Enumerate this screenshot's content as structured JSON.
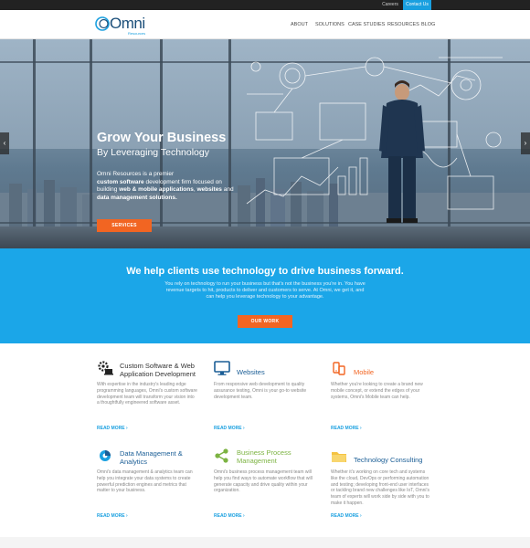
{
  "topbar": {
    "careers": "Careers",
    "contact": "Contact Us"
  },
  "brand": {
    "name": "Omni",
    "tagline": "Resources"
  },
  "nav": [
    {
      "label": "ABOUT"
    },
    {
      "label": "SOLUTIONS"
    },
    {
      "label": "CASE STUDIES"
    },
    {
      "label": "RESOURCES"
    },
    {
      "label": "BLOG"
    }
  ],
  "hero": {
    "title": "Grow Your Business",
    "subtitle": "By Leveraging Technology",
    "body_1": "Omni Resources is a premier",
    "body_2": "custom software",
    "body_3": " development firm focused on building ",
    "body_4": "web & mobile applications",
    "body_5": ", ",
    "body_6": "websites",
    "body_7": " and ",
    "body_8": "data management solutions.",
    "button": "SERVICES"
  },
  "band": {
    "title": "We help clients use technology to drive business forward.",
    "body": "You rely on technology to run your business but that's not the business you're in. You have revenue targets to hit, products to deliver and customers to serve. At Omni, we get it, and can help you leverage technology to your advantage.",
    "button": "OUR WORK"
  },
  "services": [
    {
      "title": "Custom Software & Web Application Development",
      "color": "#333333",
      "icon": "gear-laptop-icon",
      "text": "With expertise in the industry's leading edge programming languages, Omni's custom software development team will transform your vision into a thoughtfully engineered software asset.",
      "more": "READ MORE ›"
    },
    {
      "title": "Websites",
      "color": "#1b5e96",
      "icon": "monitor-icon",
      "text": "From responsive web development to quality assurance testing, Omni is your go-to website development team.",
      "more": "READ MORE ›"
    },
    {
      "title": "Mobile",
      "color": "#f26522",
      "icon": "mobile-icon",
      "text": "Whether you're looking to create a brand new mobile concept, or extend the edges of your systems, Omni's Mobile team can help.",
      "more": "READ MORE ›"
    },
    {
      "title": "Data Management & Analytics",
      "color": "#1b5e96",
      "icon": "data-icon",
      "text": "Omni's data management & analytics team can help you integrate your data systems to create powerful prediction engines and metrics that matter to your business.",
      "more": "READ MORE ›"
    },
    {
      "title": "Business Process Management",
      "color": "#7cb342",
      "icon": "share-icon",
      "text": "Omni's business process management team will help you find ways to automate workflow that will generate capacity and drive quality within your organization.",
      "more": "READ MORE ›"
    },
    {
      "title": "Technology Consulting",
      "color": "#1b5e96",
      "icon": "folder-icon",
      "text": "Whether it's working on core tech and systems like the cloud, DevOps or performing automation and testing; developing front-end user interfaces or tackling brand new challenges like IoT, Omni's team of experts will work side by side with you to make it happen.",
      "more": "READ MORE ›"
    }
  ]
}
